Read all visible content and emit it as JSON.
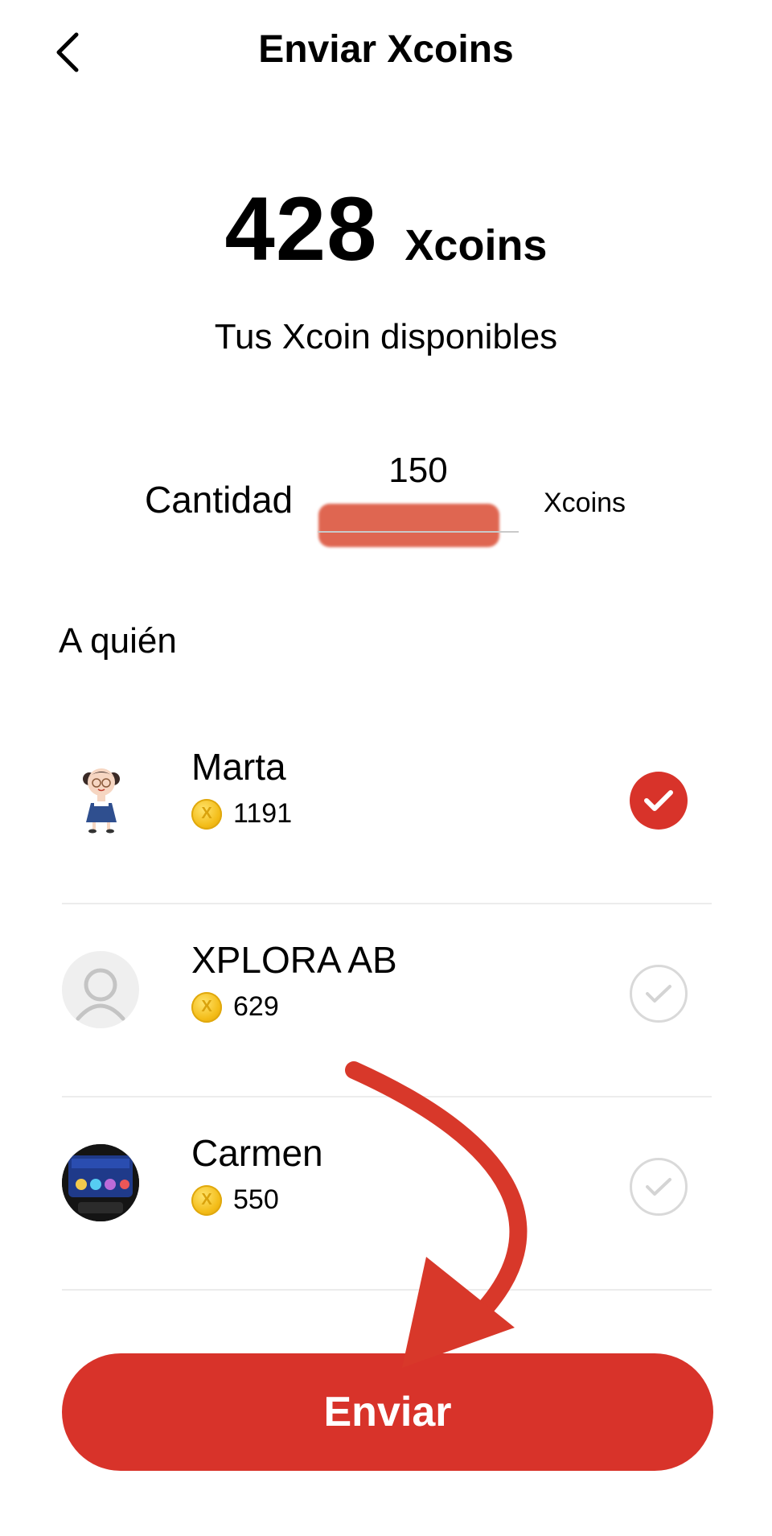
{
  "header": {
    "title": "Enviar Xcoins",
    "back_icon": "chevron-left-icon"
  },
  "balance": {
    "amount": "428",
    "unit": "Xcoins",
    "caption": "Tus Xcoin disponibles"
  },
  "amount_field": {
    "label": "Cantidad",
    "value": "150",
    "unit": "Xcoins"
  },
  "recipients": {
    "title": "A quién",
    "items": [
      {
        "name": "Marta",
        "coins": "1191",
        "selected": true,
        "avatar": "cartoon-girl-avatar"
      },
      {
        "name": "XPLORA AB",
        "coins": "629",
        "selected": false,
        "avatar": "default-person-avatar"
      },
      {
        "name": "Carmen",
        "coins": "550",
        "selected": false,
        "avatar": "watch-photo-avatar"
      }
    ]
  },
  "send_button": {
    "label": "Enviar"
  },
  "colors": {
    "accent": "#d8332a",
    "coin": "#f3bc18",
    "divider": "#ececec"
  }
}
